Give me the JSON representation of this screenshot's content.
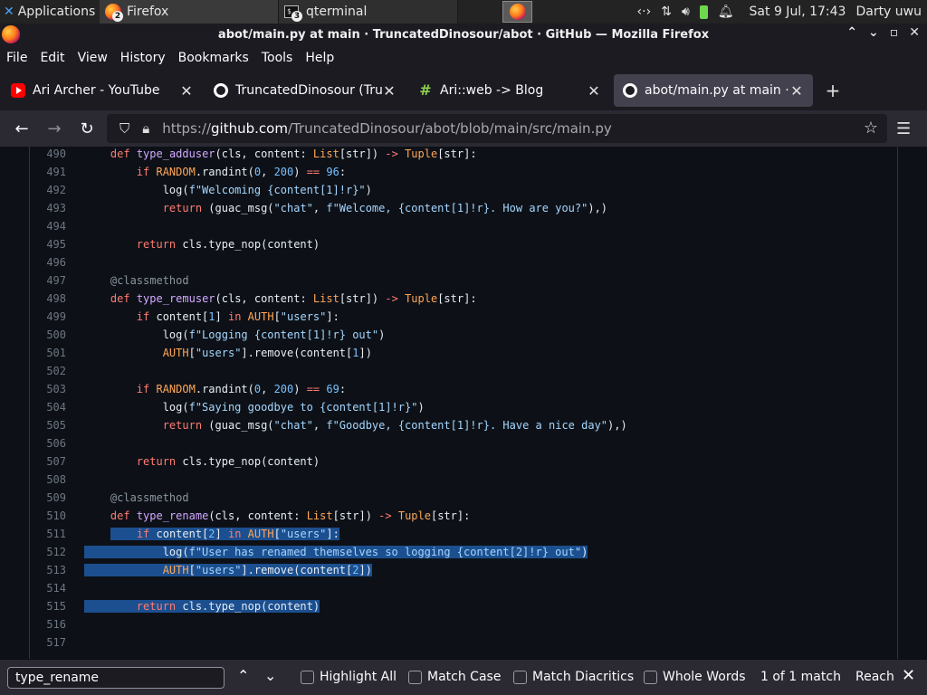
{
  "system_panel": {
    "apps_label": "Applications",
    "tasks": [
      {
        "label": "Firefox",
        "badge": "2"
      },
      {
        "label": "qterminal",
        "badge": "3"
      }
    ],
    "clock": "Sat  9 Jul, 17:43",
    "user": "Darty uwu"
  },
  "window": {
    "title": "abot/main.py at main · TruncatedDinosour/abot · GitHub — Mozilla Firefox"
  },
  "menu": [
    "File",
    "Edit",
    "View",
    "History",
    "Bookmarks",
    "Tools",
    "Help"
  ],
  "tabs": [
    {
      "label": "Ari Archer - YouTube",
      "favicon": "youtube-icon"
    },
    {
      "label": "TruncatedDinosour (Trunc",
      "favicon": "github-icon"
    },
    {
      "label": "Ari::web -> Blog",
      "favicon": "hash-icon"
    },
    {
      "label": "abot/main.py at main · Tr",
      "favicon": "github-icon",
      "active": true
    }
  ],
  "url": {
    "prefix": "https://",
    "host": "github.com",
    "path": "/TruncatedDinosour/abot/blob/main/src/main.py"
  },
  "code": [
    {
      "n": "490",
      "html": "    <span class=\"k\">def</span> <span class=\"f\">type_adduser</span>(cls, content: <span class=\"t\">List</span>[str]) <span class=\"k\">-></span> <span class=\"t\">Tuple</span>[str]:"
    },
    {
      "n": "491",
      "html": "        <span class=\"k\">if</span> <span class=\"t\">RANDOM</span>.randint(<span class=\"n\">0</span>, <span class=\"n\">200</span>) <span class=\"k\">==</span> <span class=\"n\">96</span>:"
    },
    {
      "n": "492",
      "html": "            log(<span class=\"s\">f\"Welcoming {content[1]!r}\"</span>)"
    },
    {
      "n": "493",
      "html": "            <span class=\"k\">return</span> (guac_msg(<span class=\"s\">\"chat\"</span>, <span class=\"s\">f\"Welcome, {content[1]!r}. How are you?\"</span>),)"
    },
    {
      "n": "494",
      "html": ""
    },
    {
      "n": "495",
      "html": "        <span class=\"k\">return</span> cls.type_nop(content)"
    },
    {
      "n": "496",
      "html": ""
    },
    {
      "n": "497",
      "html": "    <span class=\"g\">@classmethod</span>"
    },
    {
      "n": "498",
      "html": "    <span class=\"k\">def</span> <span class=\"f\">type_remuser</span>(cls, content: <span class=\"t\">List</span>[str]) <span class=\"k\">-></span> <span class=\"t\">Tuple</span>[str]:"
    },
    {
      "n": "499",
      "html": "        <span class=\"k\">if</span> content[<span class=\"n\">1</span>] <span class=\"k\">in</span> <span class=\"t\">AUTH</span>[<span class=\"s\">\"users\"</span>]:"
    },
    {
      "n": "500",
      "html": "            log(<span class=\"s\">f\"Logging {content[1]!r} out\"</span>)"
    },
    {
      "n": "501",
      "html": "            <span class=\"t\">AUTH</span>[<span class=\"s\">\"users\"</span>].remove(content[<span class=\"n\">1</span>])"
    },
    {
      "n": "502",
      "html": ""
    },
    {
      "n": "503",
      "html": "        <span class=\"k\">if</span> <span class=\"t\">RANDOM</span>.randint(<span class=\"n\">0</span>, <span class=\"n\">200</span>) <span class=\"k\">==</span> <span class=\"n\">69</span>:"
    },
    {
      "n": "504",
      "html": "            log(<span class=\"s\">f\"Saying goodbye to {content[1]!r}\"</span>)"
    },
    {
      "n": "505",
      "html": "            <span class=\"k\">return</span> (guac_msg(<span class=\"s\">\"chat\"</span>, <span class=\"s\">f\"Goodbye, {content[1]!r}. Have a nice day\"</span>),)"
    },
    {
      "n": "506",
      "html": ""
    },
    {
      "n": "507",
      "html": "        <span class=\"k\">return</span> cls.type_nop(content)"
    },
    {
      "n": "508",
      "html": ""
    },
    {
      "n": "509",
      "html": "    <span class=\"g\">@classmethod</span>"
    },
    {
      "n": "510",
      "html": "    <span class=\"k\">def</span> <span class=\"f\">type_rename</span>(cls, content: <span class=\"t\">List</span>[str]) <span class=\"k\">-></span> <span class=\"t\">Tuple</span>[str]:"
    },
    {
      "n": "511",
      "html": "    <span class=\"hl\">    <span class=\"k\">if</span> content[<span class=\"n\">2</span>] <span class=\"k\">in</span> <span class=\"t\">AUTH</span>[<span class=\"s\">\"users\"</span>]:</span>"
    },
    {
      "n": "512",
      "html": "<span class=\"hl\">            log(<span class=\"s\">f\"User has renamed themselves so logging {content[2]!r} out\"</span>)</span>"
    },
    {
      "n": "513",
      "html": "<span class=\"hl\">            <span class=\"t\">AUTH</span>[<span class=\"s\">\"users\"</span>].remove(content[<span class=\"n\">2</span>])</span>"
    },
    {
      "n": "514",
      "html": ""
    },
    {
      "n": "515",
      "html": "<span class=\"hl\">        <span class=\"k\">return</span> cls.type_nop(content)</span>"
    },
    {
      "n": "516",
      "html": ""
    },
    {
      "n": "517",
      "html": ""
    }
  ],
  "find": {
    "query": "type_rename",
    "options": [
      "Highlight All",
      "Match Case",
      "Match Diacritics",
      "Whole Words"
    ],
    "status": "1 of 1 match",
    "reached": "Reach"
  }
}
